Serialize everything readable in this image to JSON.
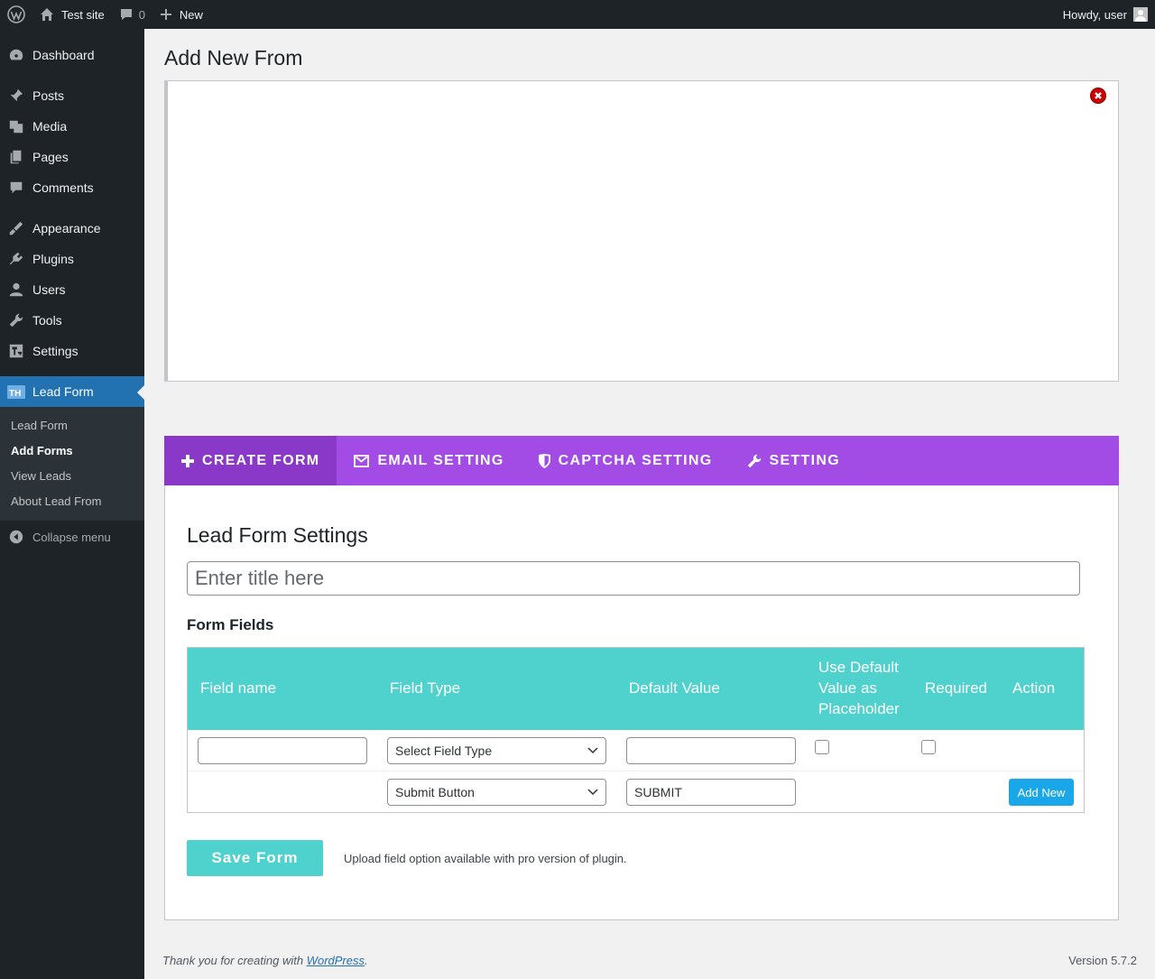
{
  "adminbar": {
    "site_name": "Test site",
    "comments_count": "0",
    "new_label": "New",
    "howdy": "Howdy, user"
  },
  "sidebar": {
    "items": [
      {
        "label": "Dashboard",
        "icon": "dashboard-icon"
      },
      {
        "label": "Posts",
        "icon": "pushpin-icon"
      },
      {
        "label": "Media",
        "icon": "media-icon"
      },
      {
        "label": "Pages",
        "icon": "pages-icon"
      },
      {
        "label": "Comments",
        "icon": "comment-icon"
      },
      {
        "label": "Appearance",
        "icon": "paintbrush-icon"
      },
      {
        "label": "Plugins",
        "icon": "plugin-icon"
      },
      {
        "label": "Users",
        "icon": "users-icon"
      },
      {
        "label": "Tools",
        "icon": "wrench-icon"
      },
      {
        "label": "Settings",
        "icon": "settings-icon"
      },
      {
        "label": "Lead Form",
        "icon": "lead-form-icon"
      }
    ],
    "submenu": [
      "Lead Form",
      "Add Forms",
      "View Leads",
      "About Lead From"
    ],
    "collapse_label": "Collapse menu"
  },
  "page": {
    "title": "Add New From"
  },
  "tabs": [
    {
      "label": "CREATE FORM",
      "icon": "plus-icon"
    },
    {
      "label": "EMAIL SETTING",
      "icon": "envelope-icon"
    },
    {
      "label": "CAPTCHA SETTING",
      "icon": "shield-icon"
    },
    {
      "label": "SETTING",
      "icon": "wrench-icon"
    }
  ],
  "panel": {
    "heading": "Lead Form Settings",
    "title_placeholder": "Enter title here",
    "fields_heading": "Form Fields",
    "columns": {
      "field_name": "Field name",
      "field_type": "Field Type",
      "default_value": "Default Value",
      "placeholder_line1": "Use Default",
      "placeholder_line2": "Value as",
      "placeholder_line3": "Placeholder",
      "required": "Required",
      "action": "Action"
    },
    "row1": {
      "field_name": "",
      "field_type": "Select Field Type",
      "default_value": "",
      "use_placeholder": false,
      "required": false
    },
    "row2": {
      "field_type": "Submit Button",
      "default_value": "SUBMIT",
      "action_label": "Add New"
    },
    "save_label": "Save Form",
    "pro_note": "Upload field option available with pro version of plugin."
  },
  "footer": {
    "thanks_prefix": "Thank you for creating with ",
    "link_text": "WordPress",
    "suffix": ".",
    "version": "Version 5.7.2"
  },
  "colors": {
    "tab_bar": "#a24ce5",
    "tab_active": "#8a38c8",
    "table_header": "#4fd1cd",
    "wp_blue": "#2271b1",
    "add_new_button": "#1aa7ea"
  }
}
